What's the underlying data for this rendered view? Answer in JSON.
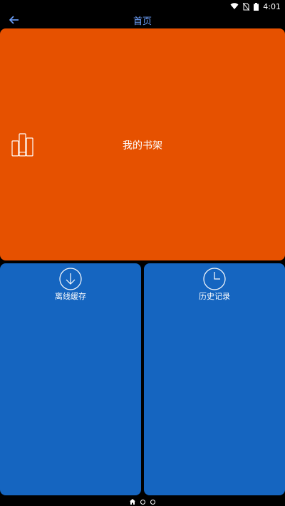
{
  "status_bar": {
    "time": "4:01",
    "icons": [
      "wifi-icon",
      "no-sim-icon",
      "battery-icon"
    ]
  },
  "app_bar": {
    "title": "首页",
    "back_icon": "arrow-left-icon",
    "title_color": "#6fa3ff"
  },
  "tiles": {
    "bookshelf": {
      "label": "我的书架",
      "icon": "bookshelf-icon",
      "color": "#e65100"
    },
    "offline": {
      "label": "离线缓存",
      "icon": "download-icon",
      "color": "#1565c0"
    },
    "history": {
      "label": "历史记录",
      "icon": "clock-icon",
      "color": "#1565c0"
    }
  },
  "page_indicator": {
    "items": [
      "home-icon",
      "page-dot",
      "page-dot"
    ],
    "active_index": 0
  }
}
